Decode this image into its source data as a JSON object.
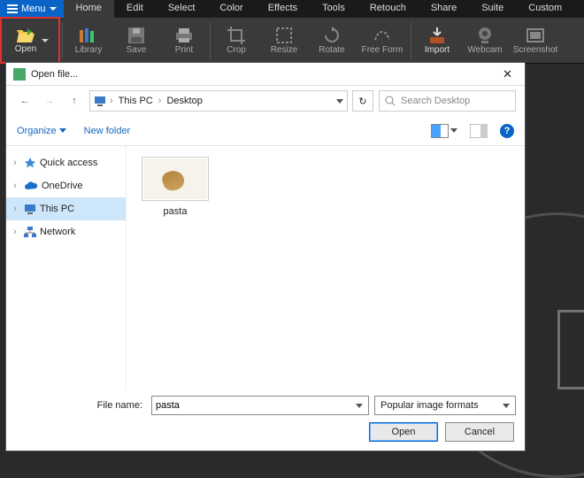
{
  "menubar": {
    "menu_label": "Menu",
    "tabs": [
      "Home",
      "Edit",
      "Select",
      "Color",
      "Effects",
      "Tools",
      "Retouch",
      "Share",
      "Suite",
      "Custom"
    ],
    "active_index": 0
  },
  "ribbon": {
    "items": [
      {
        "label": "Open",
        "icon": "folder-open-icon",
        "highlight": true
      },
      {
        "label": "Library",
        "icon": "library-icon"
      },
      {
        "label": "Save",
        "icon": "save-icon"
      },
      {
        "label": "Print",
        "icon": "print-icon"
      },
      {
        "label": "Crop",
        "icon": "crop-icon"
      },
      {
        "label": "Resize",
        "icon": "resize-icon"
      },
      {
        "label": "Rotate",
        "icon": "rotate-icon"
      },
      {
        "label": "Free Form",
        "icon": "freeform-icon"
      },
      {
        "label": "Import",
        "icon": "import-icon"
      },
      {
        "label": "Webcam",
        "icon": "webcam-icon"
      },
      {
        "label": "Screenshot",
        "icon": "screenshot-icon"
      }
    ]
  },
  "dialog": {
    "title": "Open file...",
    "breadcrumb": {
      "root": "This PC",
      "path": "Desktop"
    },
    "refresh_glyph": "↻",
    "search_placeholder": "Search Desktop",
    "organize_label": "Organize",
    "newfolder_label": "New folder",
    "help_glyph": "?",
    "sidebar": [
      {
        "label": "Quick access",
        "icon": "star-icon",
        "selected": false
      },
      {
        "label": "OneDrive",
        "icon": "cloud-icon",
        "selected": false
      },
      {
        "label": "This PC",
        "icon": "monitor-icon",
        "selected": true
      },
      {
        "label": "Network",
        "icon": "network-icon",
        "selected": false
      }
    ],
    "content": {
      "items": [
        {
          "label": "pasta"
        }
      ]
    },
    "filename_label": "File name:",
    "filename_value": "pasta",
    "filter_label": "Popular image formats",
    "open_btn": "Open",
    "cancel_btn": "Cancel",
    "close_glyph": "✕"
  }
}
